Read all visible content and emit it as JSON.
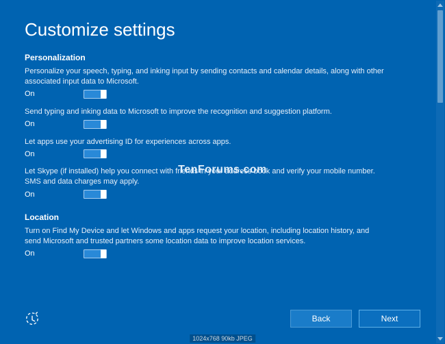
{
  "title": "Customize settings",
  "sections": {
    "personalization": {
      "header": "Personalization",
      "items": [
        {
          "desc": "Personalize your speech, typing, and inking input by sending contacts and calendar details, along with other associated input data to Microsoft.",
          "state": "On"
        },
        {
          "desc": "Send typing and inking data to Microsoft to improve the recognition and suggestion platform.",
          "state": "On"
        },
        {
          "desc": "Let apps use your advertising ID for experiences across apps.",
          "state": "On"
        },
        {
          "desc": "Let Skype (if installed) help you connect with friends in your address book and verify your mobile number. SMS and data charges may apply.",
          "state": "On"
        }
      ]
    },
    "location": {
      "header": "Location",
      "items": [
        {
          "desc": "Turn on Find My Device and let Windows and apps request your location, including location history, and send Microsoft and trusted partners some location data to improve location services.",
          "state": "On"
        }
      ]
    }
  },
  "watermark": "TenForums.com",
  "buttons": {
    "back": "Back",
    "next": "Next"
  },
  "meta": "1024x768  90kb  JPEG"
}
